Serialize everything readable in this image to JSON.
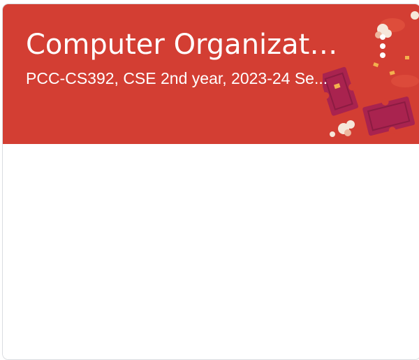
{
  "class_card": {
    "title": "Computer Organizati...",
    "section": "PCC-CS392, CSE 2nd year, 2023-24 Se...",
    "theme_color": "#d33e33",
    "menu_icon": "more-vert-icon"
  }
}
